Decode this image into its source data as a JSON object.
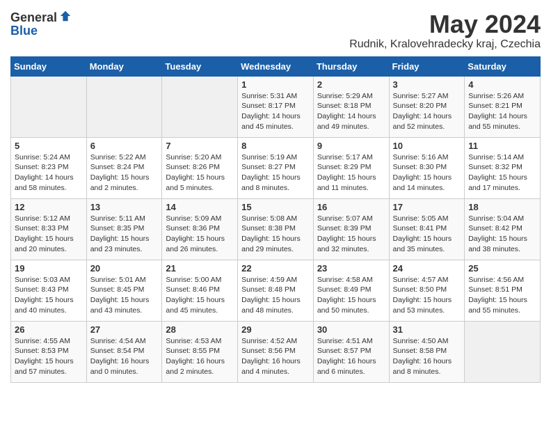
{
  "header": {
    "logo_line1": "General",
    "logo_line2": "Blue",
    "month": "May 2024",
    "location": "Rudnik, Kralovehradecky kraj, Czechia"
  },
  "weekdays": [
    "Sunday",
    "Monday",
    "Tuesday",
    "Wednesday",
    "Thursday",
    "Friday",
    "Saturday"
  ],
  "weeks": [
    [
      {
        "day": "",
        "info": ""
      },
      {
        "day": "",
        "info": ""
      },
      {
        "day": "",
        "info": ""
      },
      {
        "day": "1",
        "info": "Sunrise: 5:31 AM\nSunset: 8:17 PM\nDaylight: 14 hours\nand 45 minutes."
      },
      {
        "day": "2",
        "info": "Sunrise: 5:29 AM\nSunset: 8:18 PM\nDaylight: 14 hours\nand 49 minutes."
      },
      {
        "day": "3",
        "info": "Sunrise: 5:27 AM\nSunset: 8:20 PM\nDaylight: 14 hours\nand 52 minutes."
      },
      {
        "day": "4",
        "info": "Sunrise: 5:26 AM\nSunset: 8:21 PM\nDaylight: 14 hours\nand 55 minutes."
      }
    ],
    [
      {
        "day": "5",
        "info": "Sunrise: 5:24 AM\nSunset: 8:23 PM\nDaylight: 14 hours\nand 58 minutes."
      },
      {
        "day": "6",
        "info": "Sunrise: 5:22 AM\nSunset: 8:24 PM\nDaylight: 15 hours\nand 2 minutes."
      },
      {
        "day": "7",
        "info": "Sunrise: 5:20 AM\nSunset: 8:26 PM\nDaylight: 15 hours\nand 5 minutes."
      },
      {
        "day": "8",
        "info": "Sunrise: 5:19 AM\nSunset: 8:27 PM\nDaylight: 15 hours\nand 8 minutes."
      },
      {
        "day": "9",
        "info": "Sunrise: 5:17 AM\nSunset: 8:29 PM\nDaylight: 15 hours\nand 11 minutes."
      },
      {
        "day": "10",
        "info": "Sunrise: 5:16 AM\nSunset: 8:30 PM\nDaylight: 15 hours\nand 14 minutes."
      },
      {
        "day": "11",
        "info": "Sunrise: 5:14 AM\nSunset: 8:32 PM\nDaylight: 15 hours\nand 17 minutes."
      }
    ],
    [
      {
        "day": "12",
        "info": "Sunrise: 5:12 AM\nSunset: 8:33 PM\nDaylight: 15 hours\nand 20 minutes."
      },
      {
        "day": "13",
        "info": "Sunrise: 5:11 AM\nSunset: 8:35 PM\nDaylight: 15 hours\nand 23 minutes."
      },
      {
        "day": "14",
        "info": "Sunrise: 5:09 AM\nSunset: 8:36 PM\nDaylight: 15 hours\nand 26 minutes."
      },
      {
        "day": "15",
        "info": "Sunrise: 5:08 AM\nSunset: 8:38 PM\nDaylight: 15 hours\nand 29 minutes."
      },
      {
        "day": "16",
        "info": "Sunrise: 5:07 AM\nSunset: 8:39 PM\nDaylight: 15 hours\nand 32 minutes."
      },
      {
        "day": "17",
        "info": "Sunrise: 5:05 AM\nSunset: 8:41 PM\nDaylight: 15 hours\nand 35 minutes."
      },
      {
        "day": "18",
        "info": "Sunrise: 5:04 AM\nSunset: 8:42 PM\nDaylight: 15 hours\nand 38 minutes."
      }
    ],
    [
      {
        "day": "19",
        "info": "Sunrise: 5:03 AM\nSunset: 8:43 PM\nDaylight: 15 hours\nand 40 minutes."
      },
      {
        "day": "20",
        "info": "Sunrise: 5:01 AM\nSunset: 8:45 PM\nDaylight: 15 hours\nand 43 minutes."
      },
      {
        "day": "21",
        "info": "Sunrise: 5:00 AM\nSunset: 8:46 PM\nDaylight: 15 hours\nand 45 minutes."
      },
      {
        "day": "22",
        "info": "Sunrise: 4:59 AM\nSunset: 8:48 PM\nDaylight: 15 hours\nand 48 minutes."
      },
      {
        "day": "23",
        "info": "Sunrise: 4:58 AM\nSunset: 8:49 PM\nDaylight: 15 hours\nand 50 minutes."
      },
      {
        "day": "24",
        "info": "Sunrise: 4:57 AM\nSunset: 8:50 PM\nDaylight: 15 hours\nand 53 minutes."
      },
      {
        "day": "25",
        "info": "Sunrise: 4:56 AM\nSunset: 8:51 PM\nDaylight: 15 hours\nand 55 minutes."
      }
    ],
    [
      {
        "day": "26",
        "info": "Sunrise: 4:55 AM\nSunset: 8:53 PM\nDaylight: 15 hours\nand 57 minutes."
      },
      {
        "day": "27",
        "info": "Sunrise: 4:54 AM\nSunset: 8:54 PM\nDaylight: 16 hours\nand 0 minutes."
      },
      {
        "day": "28",
        "info": "Sunrise: 4:53 AM\nSunset: 8:55 PM\nDaylight: 16 hours\nand 2 minutes."
      },
      {
        "day": "29",
        "info": "Sunrise: 4:52 AM\nSunset: 8:56 PM\nDaylight: 16 hours\nand 4 minutes."
      },
      {
        "day": "30",
        "info": "Sunrise: 4:51 AM\nSunset: 8:57 PM\nDaylight: 16 hours\nand 6 minutes."
      },
      {
        "day": "31",
        "info": "Sunrise: 4:50 AM\nSunset: 8:58 PM\nDaylight: 16 hours\nand 8 minutes."
      },
      {
        "day": "",
        "info": ""
      }
    ]
  ]
}
